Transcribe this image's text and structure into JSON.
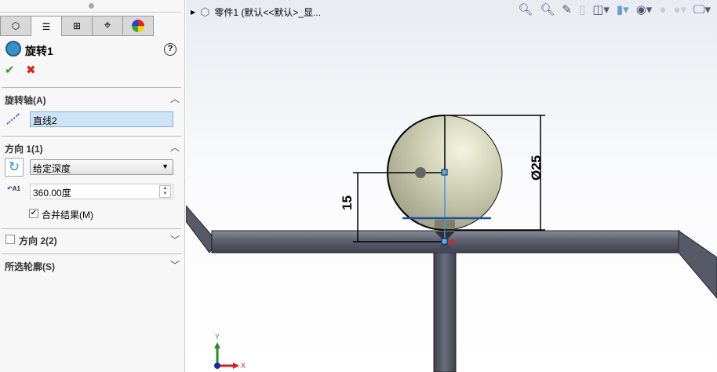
{
  "panel": {
    "tabs": [
      {
        "name": "feature-manager"
      },
      {
        "name": "property-manager"
      },
      {
        "name": "configuration-manager"
      },
      {
        "name": "dimxpert-manager"
      },
      {
        "name": "display-manager"
      }
    ],
    "feature_title": "旋转1",
    "help": "?",
    "ok": "✔",
    "cancel": "✖",
    "axis_section": {
      "title": "旋转轴(A)",
      "value": "直线2"
    },
    "dir1_section": {
      "title": "方向 1(1)",
      "end_condition": "给定深度",
      "angle": "360.00度",
      "merge_label": "合并结果(M)",
      "merge_checked": true,
      "angle_icon_label": "A1"
    },
    "dir2_section": {
      "title": "方向 2(2)",
      "checked": false
    },
    "contours_section": {
      "title": "所选轮廓(S)"
    }
  },
  "viewport": {
    "breadcrumb": "零件1  (默认<<默认>_显...",
    "dimensions": {
      "height": "15",
      "diameter": "Ø25"
    },
    "triad": {
      "x": "X",
      "y": "Y"
    }
  },
  "colors": {
    "accent": "#4a90e2",
    "pipe": "#5a5e6e",
    "sphere": "#c8c9ab"
  }
}
